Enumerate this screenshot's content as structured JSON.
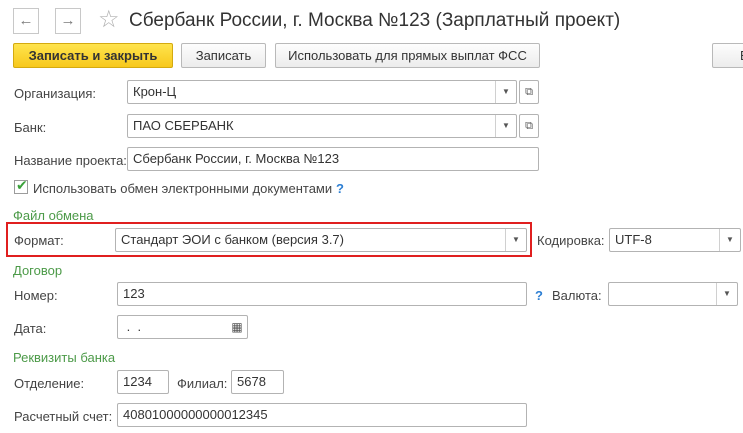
{
  "nav": {
    "back_icon": "arrow-left-icon",
    "forward_icon": "arrow-right-icon",
    "back_glyph": "←",
    "forward_glyph": "→",
    "star_icon": "star-icon",
    "star_glyph": "☆"
  },
  "title": "Сбербанк России, г. Москва №123 (Зарплатный проект)",
  "toolbar": {
    "save_close": "Записать и закрыть",
    "save": "Записать",
    "fss": "Использовать для прямых выплат ФСС",
    "more": "Ещ"
  },
  "fields": {
    "org_label": "Организация:",
    "org_value": "Крон-Ц",
    "bank_label": "Банк:",
    "bank_value": "ПАО СБЕРБАНК",
    "project_label": "Название проекта:",
    "project_value": "Сбербанк России, г. Москва №123",
    "edo_label": "Использовать обмен электронными документами",
    "edo_checked": true,
    "help": "?"
  },
  "exchange": {
    "section": "Файл обмена",
    "format_label": "Формат:",
    "format_value": "Стандарт ЭОИ с банком (версия 3.7)",
    "encoding_label": "Кодировка:",
    "encoding_value": "UTF-8"
  },
  "contract": {
    "section": "Договор",
    "number_label": "Номер:",
    "number_value": "123",
    "currency_label": "Валюта:",
    "currency_value": "",
    "date_label": "Дата:",
    "date_value": " .  .",
    "calendar_icon": "calendar-icon"
  },
  "bank_details": {
    "section": "Реквизиты банка",
    "branch_label": "Отделение:",
    "branch_value": "1234",
    "filial_label": "Филиал:",
    "filial_value": "5678",
    "account_label": "Расчетный счет:",
    "account_value": "40801000000000012345"
  },
  "icons": {
    "dropdown": "▼",
    "open": "⧉",
    "check": "✔",
    "calendar": "▦"
  },
  "colors": {
    "section_green": "#4c9a48",
    "primary_yellow": "#f7c81c",
    "highlight_red": "#e01f1f",
    "help_blue": "#2d7fd3"
  }
}
